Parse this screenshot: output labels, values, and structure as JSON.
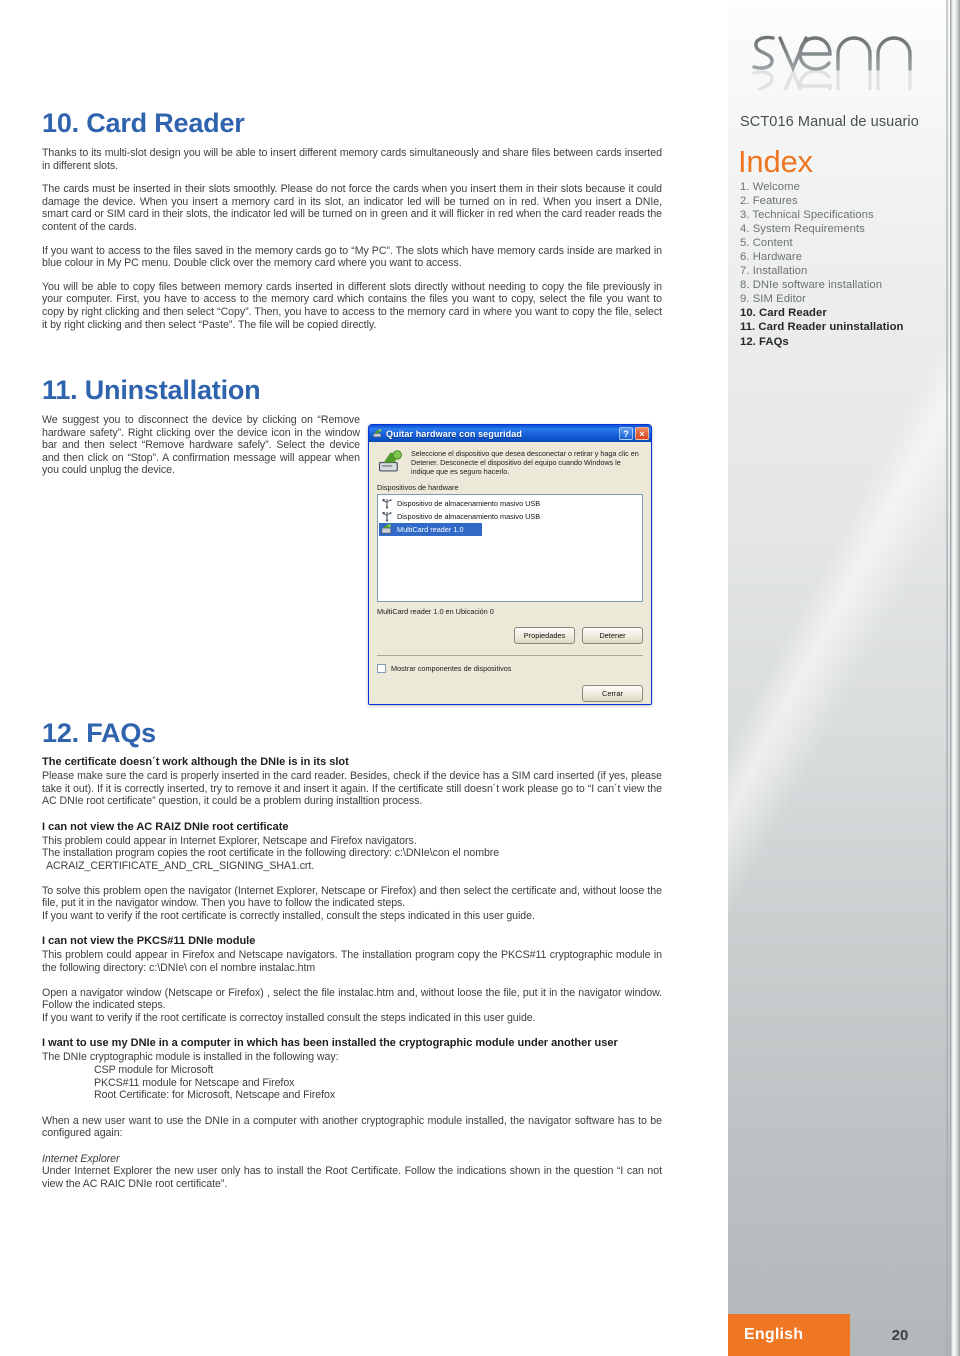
{
  "brand": {
    "logo_text": "sveon"
  },
  "sidebar": {
    "manual_title": "SCT016 Manual de usuario",
    "index_heading": "Index",
    "index_items": [
      {
        "label": "1. Welcome",
        "current": false
      },
      {
        "label": "2. Features",
        "current": false
      },
      {
        "label": "3. Technical Specifications",
        "current": false
      },
      {
        "label": "4. System Requirements",
        "current": false
      },
      {
        "label": "5. Content",
        "current": false
      },
      {
        "label": "6. Hardware",
        "current": false
      },
      {
        "label": "7. Installation",
        "current": false
      },
      {
        "label": "8. DNIe software installation",
        "current": false
      },
      {
        "label": "9. SIM Editor",
        "current": false
      },
      {
        "label": "10. Card Reader",
        "current": true
      },
      {
        "label": "11. Card Reader uninstallation",
        "current": true
      },
      {
        "label": "12. FAQs",
        "current": true
      }
    ]
  },
  "section10": {
    "heading": "10. Card Reader",
    "p1": "Thanks to its multi-slot design you will be able to insert different memory cards simultaneously and share files between cards inserted in different slots.",
    "p2": "The cards must be inserted in their slots smoothly. Please do not force the cards when you insert them in their slots because it could damage the device. When you insert a memory card in its slot, an indicator led will be turned on in red. When you insert a DNIe, smart card or SIM card in their slots, the indicator led will be turned on in green and it will flicker in red when the card reader reads the content of the cards.",
    "p3": "If you want to access to the files saved in the memory cards go to “My PC”. The slots which have memory cards inside are marked in blue colour in My PC menu. Double click over the memory card where you want to access.",
    "p4": "You will be able to copy files between memory cards inserted in different slots directly without needing to copy the file previously in your computer. First, you have to access to the memory card which contains the files you want to copy, select the file you want to copy by right clicking and then select “Copy”. Then, you have to access to the memory card in where you want to copy the file, select it by right clicking and then select “Paste”. The file will be copied directly."
  },
  "section11": {
    "heading": "11. Uninstallation",
    "p1": "We suggest you to disconnect the device by clicking on “Remove hardware safety”. Right clicking over the device icon in the window bar and then select “Remove hardware safely”. Select the device and then click on “Stop”. A confirmation message will appear when you could unplug the device."
  },
  "dialog": {
    "title": "Quitar hardware con seguridad",
    "help_button": "?",
    "close_button": "×",
    "intro": "Seleccione el dispositivo que desea desconectar o retirar y haga clic en Detener. Desconecte el dispositivo del equipo cuando Windows le indique que es seguro hacerlo.",
    "list_label": "Dispositivos de hardware",
    "devices": [
      {
        "label": "Dispositivo de almacenamiento masivo USB",
        "selected": false
      },
      {
        "label": "Dispositivo de almacenamiento masivo USB",
        "selected": false
      },
      {
        "label": "MultiCard reader 1.0",
        "selected": true
      }
    ],
    "status": "MultiCard reader 1.0 en Ubicación 0",
    "properties_button": "Propiedades",
    "stop_button": "Detener",
    "checkbox_label": "Mostrar componentes de dispositivos",
    "close_bottom_button": "Cerrar"
  },
  "section12": {
    "heading": "12. FAQs",
    "q1_title": "The certificate doesn´t work although the DNIe is in its slot",
    "q1_body": "Please make sure the card is properly inserted in the card reader. Besides, check if the device has a SIM card inserted (if yes, please take it out). If it is correctly inserted, try to remove it and insert it again.  If the certificate still doesn´t work please go to “I can´t view the AC DNIe root certificate” question, it could be a problem during installtion process.",
    "q2_title": "I can not view the AC RAIZ DNIe root certificate",
    "q2_body_l1": "This problem could appear in Internet Explorer, Netscape and Firefox navigators.",
    "q2_body_l2": "The installation program copies the root certificate in the following directory:  c:\\DNIe\\con el nombre",
    "q2_body_l3": "ACRAIZ_CERTIFICATE_AND_CRL_SIGNING_SHA1.crt.",
    "q2_extra": "To solve this problem open the navigator (Internet Explorer, Netscape or Firefox) and then select the certificate and, without loose the file, put it in the navigator window. Then you have to follow the indicated steps.",
    "q2_extra2": "If you want to verify if the root certificate is correctly installed, consult the steps indicated in this user guide.",
    "q3_title": "I can not view the PKCS#11 DNIe module",
    "q3_body": "This problem could appear in Firefox and Netscape navigators. The installation program copy the PKCS#11 cryptographic module in the following directory: c:\\DNIe\\ con el nombre instalac.htm",
    "q3_extra": "Open a navigator window (Netscape or Firefox) , select the file instalac.htm and, without loose the file, put it in the navigator window. Follow the indicated steps.",
    "q3_extra2": "If you want to verify if the root certificate is correctoy installed consult the steps indicated in this user guide.",
    "q4_title": "I want to use my DNIe in a computer in which has been installed the cryptographic module under another user",
    "q4_body": "The DNIe cryptographic module is installed in the following way:",
    "q4_item1": "CSP module for Microsoft",
    "q4_item2": "PKCS#11 module for Netscape and Firefox",
    "q4_item3": "Root Certificate: for Microsoft, Netscape and Firefox",
    "q4_extra": "When a new user want to use the DNIe in a computer with another cryptographic module installed, the navigator software has to be configured again:",
    "q4_sub": "Internet Explorer",
    "q4_sub_body": "Under Internet Explorer the new user only has to install the Root Certificate. Follow the indications shown in the question “I can not view the AC RAIC DNIe root certificate”."
  },
  "footer": {
    "language": "English",
    "page_number": "20"
  },
  "colors": {
    "heading_blue": "#2f63ae",
    "accent_orange": "#ef7622",
    "sidebar_text": "#6d7275"
  }
}
